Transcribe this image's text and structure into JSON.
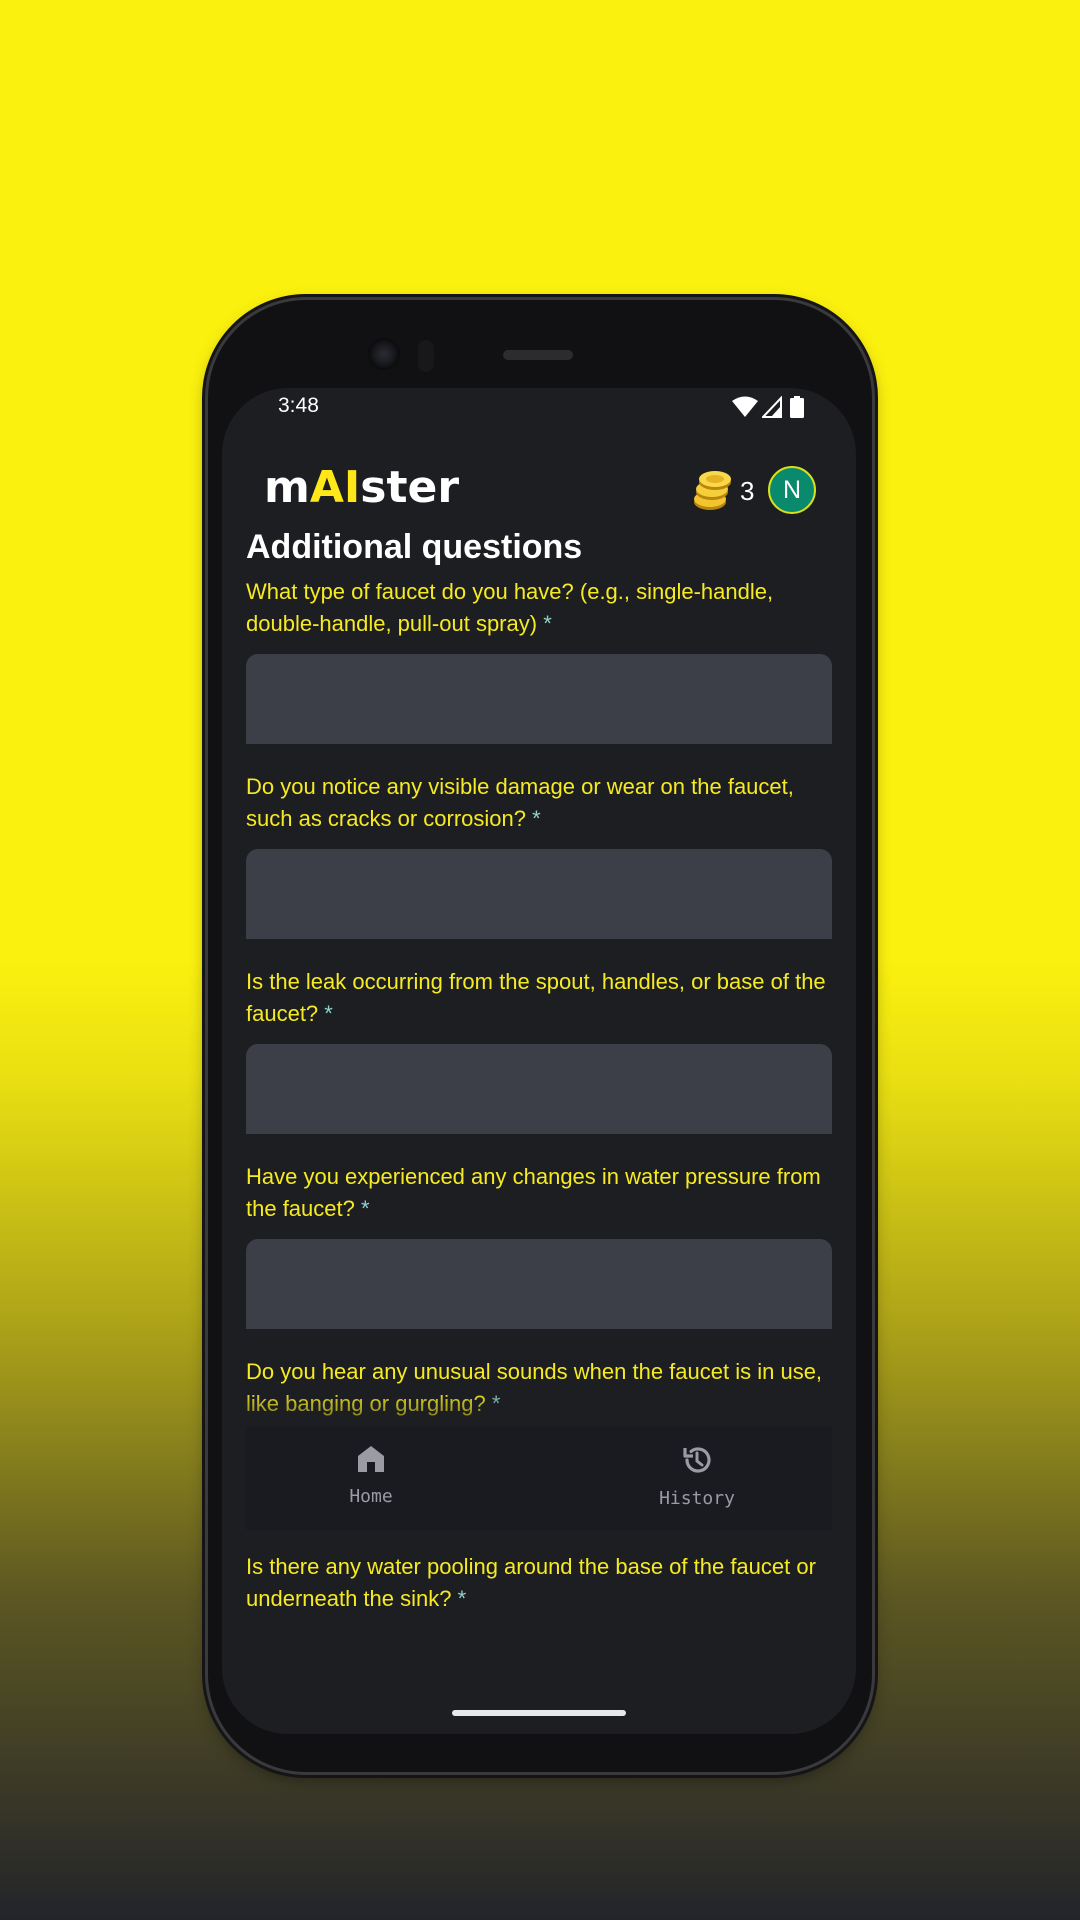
{
  "status_bar": {
    "time": "3:48"
  },
  "header": {
    "logo_prefix": "m",
    "logo_highlight": "AI",
    "logo_suffix": "ster",
    "coin_count": "3",
    "avatar_initial": "N"
  },
  "page": {
    "title": "Additional questions"
  },
  "questions": [
    {
      "label": "What type of faucet do you have? (e.g., single-handle, double-handle, pull-out spray)",
      "required_mark": "*",
      "value": ""
    },
    {
      "label": "Do you notice any visible damage or wear on the faucet, such as cracks or corrosion?",
      "required_mark": "*",
      "value": ""
    },
    {
      "label": "Is the leak occurring from the spout, handles, or base of the faucet?",
      "required_mark": "*",
      "value": ""
    },
    {
      "label": "Have you experienced any changes in water pressure from the faucet?",
      "required_mark": "*",
      "value": ""
    },
    {
      "label": "Do you hear any unusual sounds when the faucet is in use, like banging or gurgling?",
      "required_mark": "*",
      "value": ""
    },
    {
      "label": "Is there any water pooling around the base of the faucet or underneath the sink?",
      "required_mark": "*"
    }
  ],
  "bottom_nav": {
    "home_label": "Home",
    "history_label": "History"
  },
  "colors": {
    "background_yellow": "#fbf10f",
    "screen_bg": "#1d1e22",
    "question_text": "#f6ea22",
    "required_mark": "#8fd3c9",
    "input_bg": "#3c3e48",
    "avatar_bg": "#0a8a6d"
  },
  "icons": [
    "wifi-icon",
    "signal-icon",
    "battery-icon",
    "coins-icon",
    "home-icon",
    "history-icon"
  ]
}
